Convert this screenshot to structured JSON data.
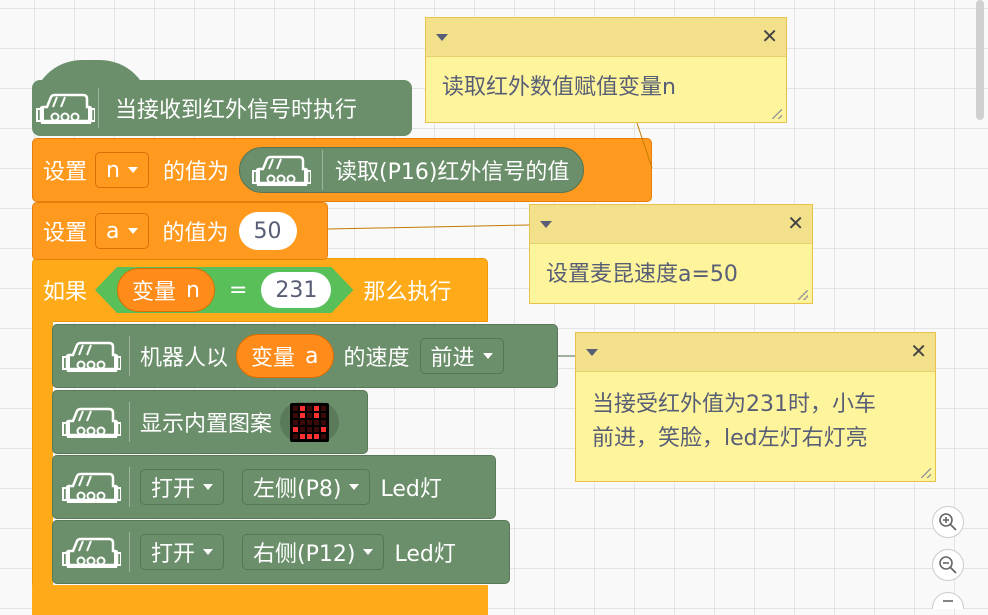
{
  "blocks": {
    "hat_label": "当接收到红外信号时执行",
    "set_label": "设置",
    "value_label": "的值为",
    "set1_var": "n",
    "read_ir_label": "读取(P16)红外信号的值",
    "set2_var": "a",
    "set2_value": "50",
    "if_label": "如果",
    "var_label": "变量",
    "var_n": "n",
    "equals": "=",
    "compare_value": "231",
    "then_label": "那么执行",
    "robot_label": "机器人以",
    "var_a": "a",
    "speed_label": "的速度",
    "direction": "前进",
    "show_icon_label": "显示内置图案",
    "open1": "打开",
    "left_led": "左侧(P8)",
    "led_label": "Led灯",
    "open2": "打开",
    "right_led": "右侧(P12)"
  },
  "comments": {
    "c1": "读取红外数值赋值变量n",
    "c2": "设置麦昆速度a=50",
    "c3_line1": "当接受红外值为231时，小车",
    "c3_line2": "前进，笑脸，led左灯右灯亮"
  },
  "icons": {
    "robot": "robot-car-icon",
    "zoom_in": "zoom-in-icon",
    "zoom_out": "zoom-out-icon",
    "reset": "zoom-reset-icon"
  },
  "colors": {
    "hat_green": "#6b8f6b",
    "orange": "#ff9a1f",
    "if_yellow": "#ffab19",
    "compare_green": "#59c059",
    "comment_bg": "#fef49c"
  }
}
